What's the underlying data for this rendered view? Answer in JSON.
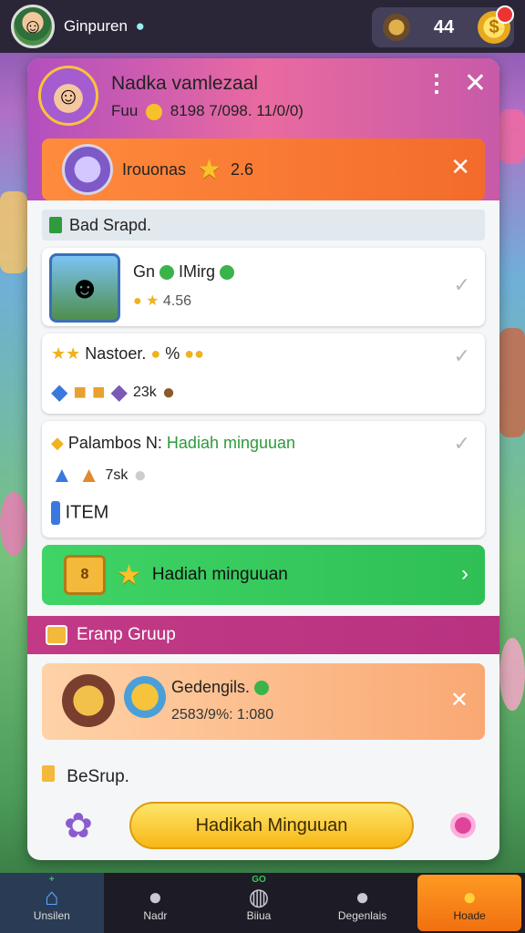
{
  "topbar": {
    "player_name": "Ginpuren",
    "gem_glyph": "●",
    "currency_value": "44",
    "coin_symbol": "$"
  },
  "panel": {
    "header": {
      "title": "Nadka vamlezaal",
      "sub_label": "Fuu",
      "sub_value": "8198 7/098. 11/0/0)"
    },
    "banner": {
      "label": "Irouonas",
      "value": "2.6"
    },
    "section1_title": "Bad Srapd.",
    "card1": {
      "title": "Gn",
      "title2": "IMirg",
      "sub": "4.56"
    },
    "card2": {
      "title": "Nastoer.",
      "tag": "%",
      "count": "23k"
    },
    "card3": {
      "title": "Palambos N:",
      "highlight": "Hadiah minguuan",
      "count": "7sk",
      "item_label": "ITEM"
    },
    "green_banner": {
      "label": "Hadiah minguuan"
    },
    "pink_strip": "Eranp Gruup",
    "peach_card": {
      "title": "Gedengils.",
      "sub": "2583/9%: 1:080"
    },
    "section2_title": "BeSrup.",
    "action_button": "Hadikah Minguuan"
  },
  "bottom_nav": [
    {
      "label": "Unsilen",
      "icon": "home-icon",
      "badge": "+"
    },
    {
      "label": "Nadr",
      "icon": "friends-icon",
      "badge": ""
    },
    {
      "label": "Biiua",
      "icon": "globe-icon",
      "badge": "GO"
    },
    {
      "label": "Degenlais",
      "icon": "group-icon",
      "badge": ""
    },
    {
      "label": "Hoade",
      "icon": "coin-icon",
      "badge": ""
    }
  ],
  "colors": {
    "accent_orange": "#f36b2b",
    "accent_green": "#2fbf55",
    "accent_pink": "#c23a86",
    "button_yellow": "#f7b716"
  }
}
